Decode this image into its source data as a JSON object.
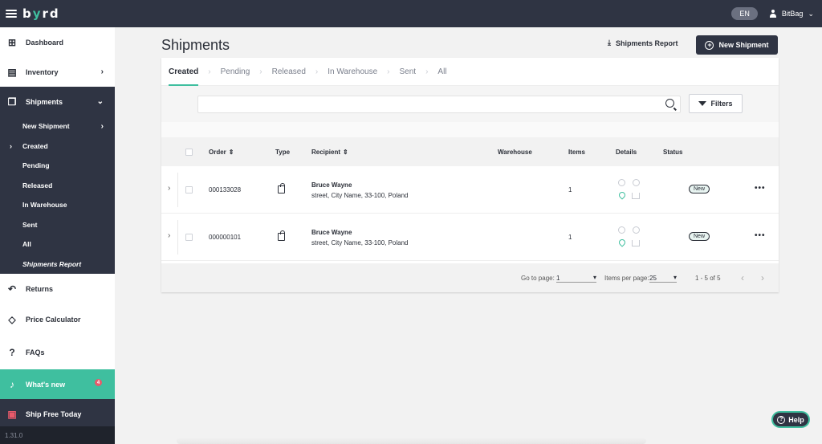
{
  "topbar": {
    "logo": "byrd",
    "lang": "EN",
    "user": "BitBag"
  },
  "sidebar": {
    "items": [
      {
        "label": "Dashboard"
      },
      {
        "label": "Inventory"
      },
      {
        "label": "Shipments"
      },
      {
        "label": "Returns"
      },
      {
        "label": "Price Calculator"
      },
      {
        "label": "FAQs"
      },
      {
        "label": "What's new",
        "badge": "4"
      },
      {
        "label": "Ship Free Today"
      }
    ],
    "sub_items": [
      "New Shipment",
      "Created",
      "Pending",
      "Released",
      "In Warehouse",
      "Sent",
      "All",
      "Shipments Report"
    ],
    "version": "1.31.0"
  },
  "main": {
    "title": "Shipments",
    "report_label": "Shipments Report",
    "new_label": "New Shipment",
    "tabs": [
      "Created",
      "Pending",
      "Released",
      "In Warehouse",
      "Sent",
      "All"
    ],
    "search_placeholder": "",
    "filters_label": "Filters",
    "columns": [
      "Order",
      "Type",
      "Recipient",
      "Warehouse",
      "Items",
      "Details",
      "Status"
    ],
    "rows": [
      {
        "order": "000133028",
        "name": "Bruce Wayne",
        "address": "street, City Name, 33-100, Poland",
        "items": "1",
        "status": "New"
      },
      {
        "order": "000000101",
        "name": "Bruce Wayne",
        "address": "street, City Name, 33-100, Poland",
        "items": "1",
        "status": "New"
      }
    ],
    "footer": {
      "goto_label": "Go to page:",
      "goto_value": "1",
      "perpage_label": "Items per page:",
      "perpage_value": "25",
      "range": "1 - 5 of 5"
    }
  },
  "help_label": "Help",
  "colors": {
    "accent": "#3fbf9f",
    "dark": "#2f3443",
    "badge": "#e85a6b"
  }
}
